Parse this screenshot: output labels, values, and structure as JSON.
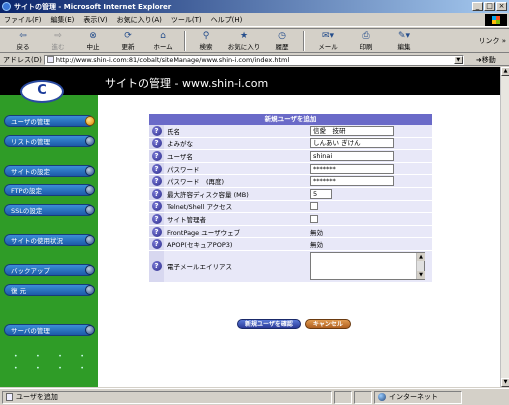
{
  "window": {
    "title": "サイトの管理 - Microsoft Internet Explorer",
    "minimize": "_",
    "maximize": "□",
    "close": "×"
  },
  "menu": [
    "ファイル(F)",
    "編集(E)",
    "表示(V)",
    "お気に入り(A)",
    "ツール(T)",
    "ヘルプ(H)"
  ],
  "toolbar": {
    "back": "戻る",
    "forward": "進む",
    "stop": "中止",
    "refresh": "更新",
    "home": "ホーム",
    "search": "検索",
    "favorites": "お気に入り",
    "history": "履歴",
    "mail": "メール",
    "print": "印刷",
    "edit": "編集",
    "links": "リンク »"
  },
  "address": {
    "label": "アドレス(D)",
    "url": "http://www.shin-i.com:81/cobalt/siteManage/www.shin-i.com/index.html",
    "go": "移動"
  },
  "site": {
    "title": "サイトの管理 - www.shin-i.com"
  },
  "sidebar": {
    "items": [
      {
        "label": "ユーザの管理",
        "active": true
      },
      {
        "label": "リストの管理",
        "active": false
      },
      {
        "label": "サイトの設定",
        "active": false
      },
      {
        "label": "FTPの設定",
        "active": false
      },
      {
        "label": "SSLの設定",
        "active": false
      },
      {
        "label": "サイトの使用状況",
        "active": false
      },
      {
        "label": "バックアップ",
        "active": false
      },
      {
        "label": "復 元",
        "active": false
      },
      {
        "label": "サーバの管理",
        "active": false
      }
    ]
  },
  "form": {
    "header": "新規ユーザを追加",
    "fields": {
      "fullname": {
        "label": "氏名",
        "value": "信愛　技研"
      },
      "reading": {
        "label": "よみがな",
        "value": "しんあい ぎけん"
      },
      "username": {
        "label": "ユーザ名",
        "value": "shinai"
      },
      "password": {
        "label": "パスワード",
        "value": "*******"
      },
      "password_confirm": {
        "label": "パスワード　(再度)",
        "value": "*******"
      },
      "quota": {
        "label": "最大許容ディスク容量 (MB)",
        "value": "5"
      },
      "telnet": {
        "label": "Telnet/Shell アクセス",
        "checked": false
      },
      "site_admin": {
        "label": "サイト管理者",
        "checked": false
      },
      "frontpage": {
        "label": "FrontPage ユーザウェブ",
        "value": "無効"
      },
      "apop": {
        "label": "APOP(セキュアPOP3)",
        "value": "無効"
      },
      "email_alias": {
        "label": "電子メールエイリアス",
        "value": ""
      }
    },
    "confirm_button": "新規ユーザを確認",
    "cancel_button": "キャンセル"
  },
  "statusbar": {
    "text": "ユーザを追加",
    "zone": "インターネット"
  }
}
